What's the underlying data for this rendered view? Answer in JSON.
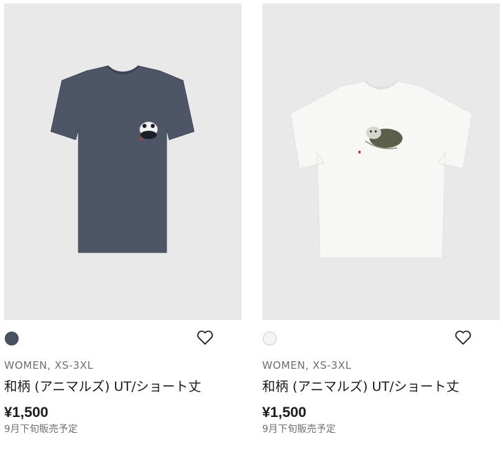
{
  "products": [
    {
      "swatch_color": "#495263",
      "shirt_color": "#4d5566",
      "print": "panda-icon",
      "meta": "WOMEN, XS-3XL",
      "title": "和柄 (アニマルズ) UT/ショート丈",
      "price": "¥1,500",
      "note": "9月下旬販売予定"
    },
    {
      "swatch_color": "#f4f4f2",
      "shirt_color": "#f7f7f5",
      "print": "cat-icon",
      "meta": "WOMEN, XS-3XL",
      "title": "和柄 (アニマルズ) UT/ショート丈",
      "price": "¥1,500",
      "note": "9月下旬販売予定"
    }
  ]
}
